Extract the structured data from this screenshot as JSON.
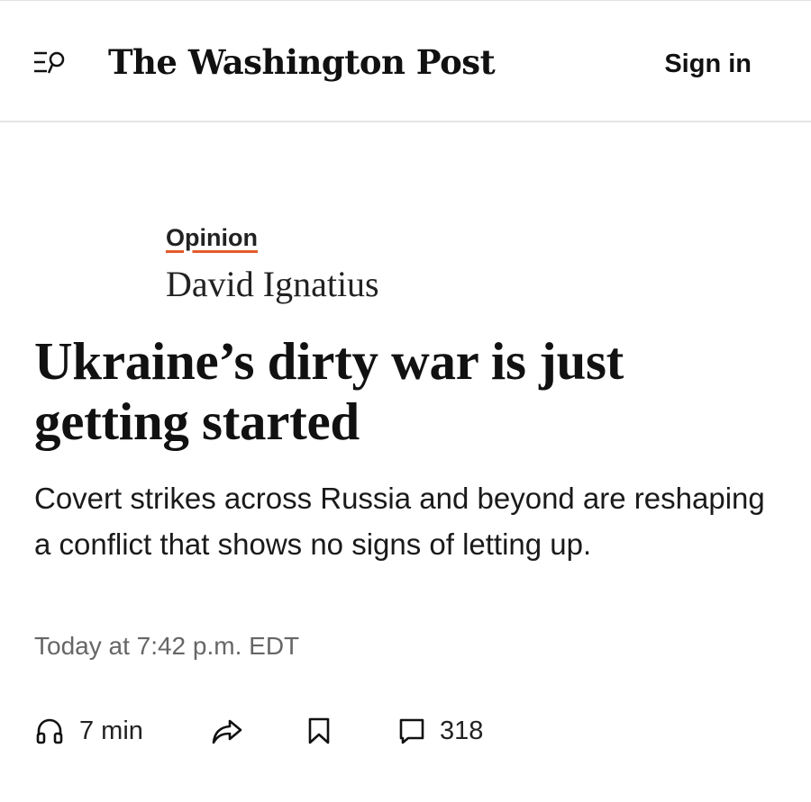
{
  "header": {
    "logo": "The Washington Post",
    "sign_in": "Sign in",
    "menu_icon": "menu-search-icon"
  },
  "article": {
    "section": "Opinion",
    "author": "David Ignatius",
    "headline": "Ukraine’s dirty war is just getting started",
    "dek": "Covert strikes across Russia and beyond are reshaping a conflict that shows no signs of letting up.",
    "timestamp": "Today at 7:42 p.m. EDT"
  },
  "actions": {
    "listen_icon": "headphones-icon",
    "listen_label": "7 min",
    "share_icon": "share-icon",
    "save_icon": "bookmark-icon",
    "comments_icon": "comment-icon",
    "comments_count": "318"
  },
  "colors": {
    "text": "#111111",
    "muted": "#666666",
    "accent_underline": "#e35a2b",
    "divider": "#e6e6e6"
  }
}
